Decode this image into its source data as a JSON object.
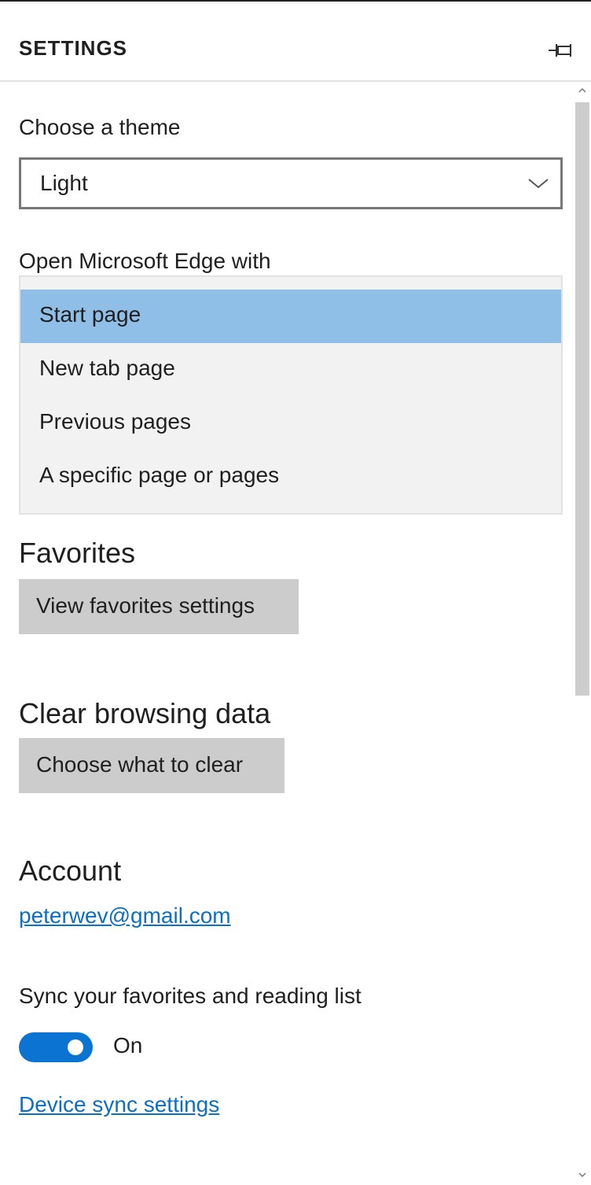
{
  "header": {
    "title": "SETTINGS",
    "pin_icon": "pin-icon"
  },
  "theme": {
    "label": "Choose a theme",
    "selected": "Light",
    "icon": "chevron-down-icon"
  },
  "open_with": {
    "label": "Open Microsoft Edge with",
    "options": [
      {
        "label": "Start page",
        "selected": true
      },
      {
        "label": "New tab page",
        "selected": false
      },
      {
        "label": "Previous pages",
        "selected": false
      },
      {
        "label": "A specific page or pages",
        "selected": false
      }
    ],
    "selected_color": "#8fbfe6"
  },
  "favorites": {
    "title": "Favorites",
    "button_label": "View favorites settings"
  },
  "clear_data": {
    "title": "Clear browsing data",
    "button_label": "Choose what to clear"
  },
  "account": {
    "title": "Account",
    "email": "peterwev@gmail.com"
  },
  "sync": {
    "label": "Sync your favorites and reading list",
    "toggle_state": "On",
    "toggle_color": "#0b73d1",
    "device_link": "Device sync settings"
  },
  "colors": {
    "link": "#0b6fc3",
    "button_bg": "#cccccc"
  }
}
